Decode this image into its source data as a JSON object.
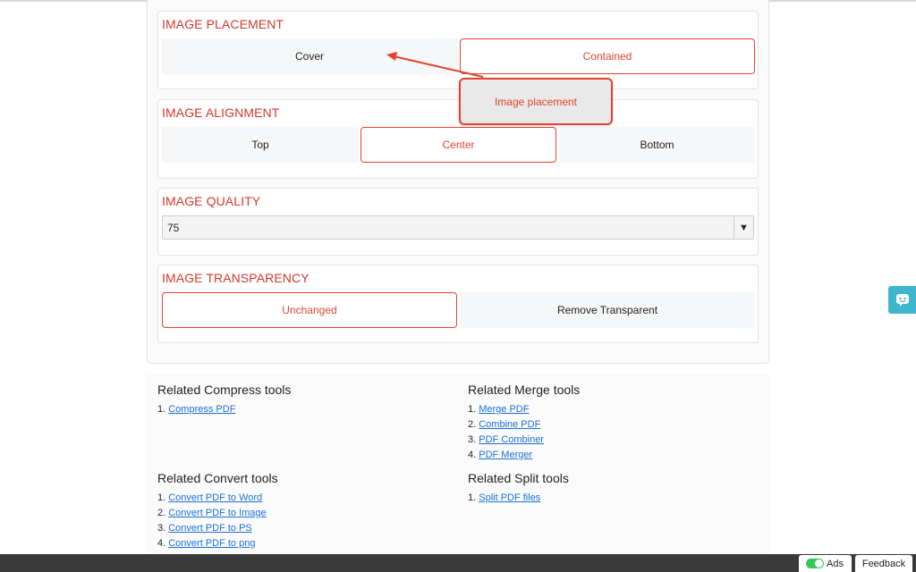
{
  "placement": {
    "title": "IMAGE PLACEMENT",
    "options": [
      "Cover",
      "Contained"
    ],
    "selected": "Contained"
  },
  "alignment": {
    "title": "IMAGE ALIGNMENT",
    "options": [
      "Top",
      "Center",
      "Bottom"
    ],
    "selected": "Center"
  },
  "quality": {
    "title": "IMAGE QUALITY",
    "value": "75"
  },
  "transparency": {
    "title": "IMAGE TRANSPARENCY",
    "options": [
      "Unchanged",
      "Remove Transparent"
    ],
    "selected": "Unchanged"
  },
  "tooltip": {
    "text": "Image placement"
  },
  "related": {
    "compress": {
      "title": "Related Compress tools",
      "items": [
        "Compress PDF"
      ]
    },
    "merge": {
      "title": "Related Merge tools",
      "items": [
        "Merge PDF",
        "Combine PDF",
        "PDF Combiner",
        "PDF Merger"
      ]
    },
    "convert": {
      "title": "Related Convert tools",
      "items": [
        "Convert PDF to Word",
        "Convert PDF to Image",
        "Convert PDF to PS",
        "Convert PDF to png"
      ]
    },
    "split": {
      "title": "Related Split tools",
      "items": [
        "Split PDF files"
      ]
    }
  },
  "footer": {
    "ads_label": "Ads",
    "feedback_label": "Feedback"
  },
  "colors": {
    "accent": "#e0442e",
    "link": "#1a6fd6",
    "chat": "#3fb6cf"
  },
  "icons": {
    "chat": "chat-bubble-icon",
    "select": "dropdown-arrow-icon"
  }
}
